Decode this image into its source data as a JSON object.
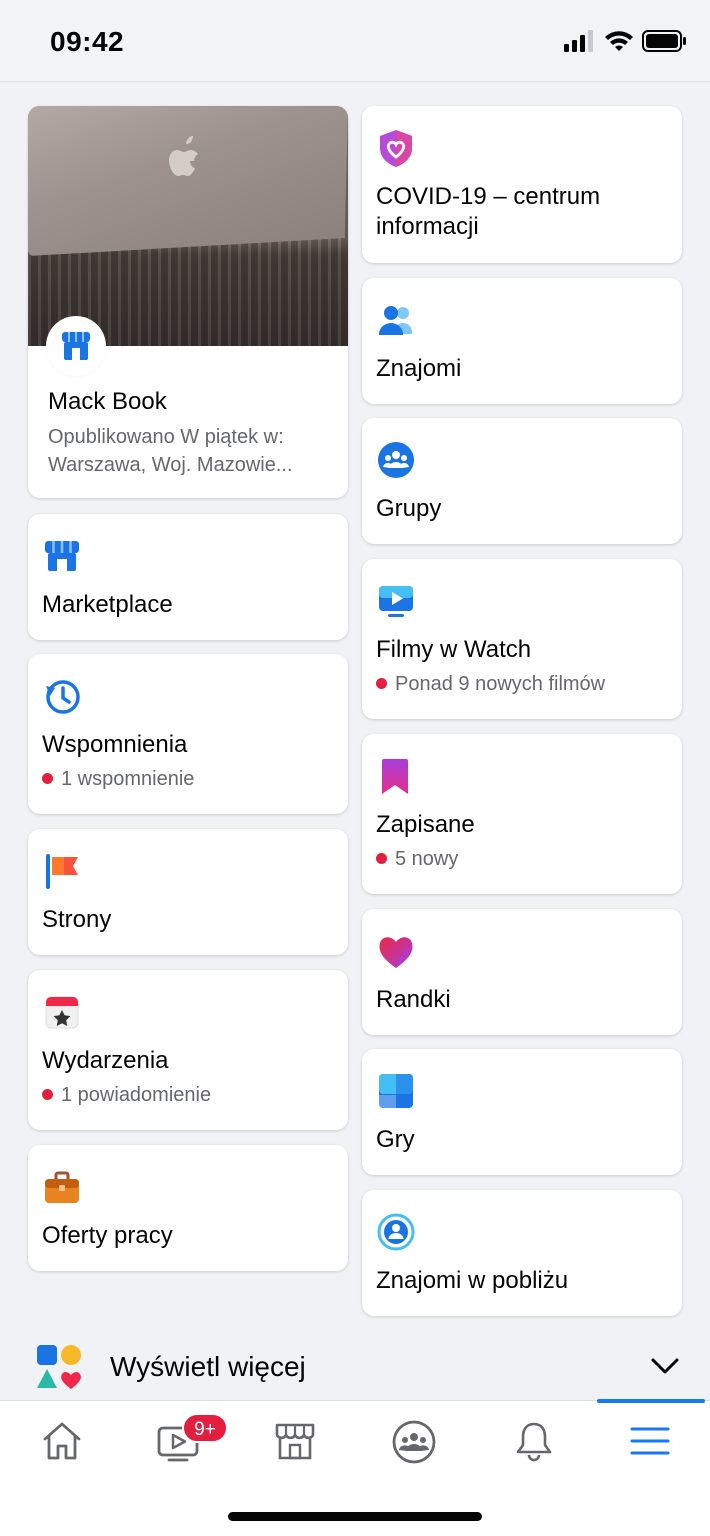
{
  "status_bar": {
    "time": "09:42"
  },
  "featured": {
    "title": "Mack Book",
    "line1": "Opublikowano W piątek w:",
    "line2": "Warszawa, Woj. Mazowie..."
  },
  "left_column": [
    {
      "id": "marketplace",
      "label": "Marketplace",
      "sub": null,
      "icon": "marketplace-icon"
    },
    {
      "id": "memories",
      "label": "Wspomnienia",
      "sub": "1 wspomnienie",
      "icon": "memories-icon"
    },
    {
      "id": "pages",
      "label": "Strony",
      "sub": null,
      "icon": "pages-flag-icon"
    },
    {
      "id": "events",
      "label": "Wydarzenia",
      "sub": "1 powiadomienie",
      "icon": "events-calendar-icon"
    },
    {
      "id": "jobs",
      "label": "Oferty pracy",
      "sub": null,
      "icon": "jobs-briefcase-icon"
    }
  ],
  "right_column": [
    {
      "id": "covid",
      "label_line1": "COVID-19 – centrum",
      "label_line2": "informacji",
      "icon": "covid-shield-icon"
    },
    {
      "id": "friends",
      "label": "Znajomi",
      "icon": "friends-icon"
    },
    {
      "id": "groups",
      "label": "Grupy",
      "icon": "groups-icon"
    },
    {
      "id": "watch",
      "label": "Filmy w Watch",
      "sub": "Ponad 9 nowych filmów",
      "icon": "watch-icon"
    },
    {
      "id": "saved",
      "label": "Zapisane",
      "sub": "5 nowy",
      "icon": "saved-bookmark-icon"
    },
    {
      "id": "dating",
      "label": "Randki",
      "icon": "dating-heart-icon"
    },
    {
      "id": "gaming",
      "label": "Gry",
      "icon": "gaming-icon"
    },
    {
      "id": "nearby",
      "label": "Znajomi w pobliżu",
      "icon": "nearby-friends-icon"
    }
  ],
  "show_more": {
    "label": "Wyświetl więcej"
  },
  "bottom_nav": {
    "watch_badge": "9+",
    "active_tab": "menu"
  },
  "colors": {
    "accent": "#1877f2",
    "notification_red": "#e41e3f",
    "background": "#f0f2f5",
    "secondary_text": "#65676b"
  }
}
